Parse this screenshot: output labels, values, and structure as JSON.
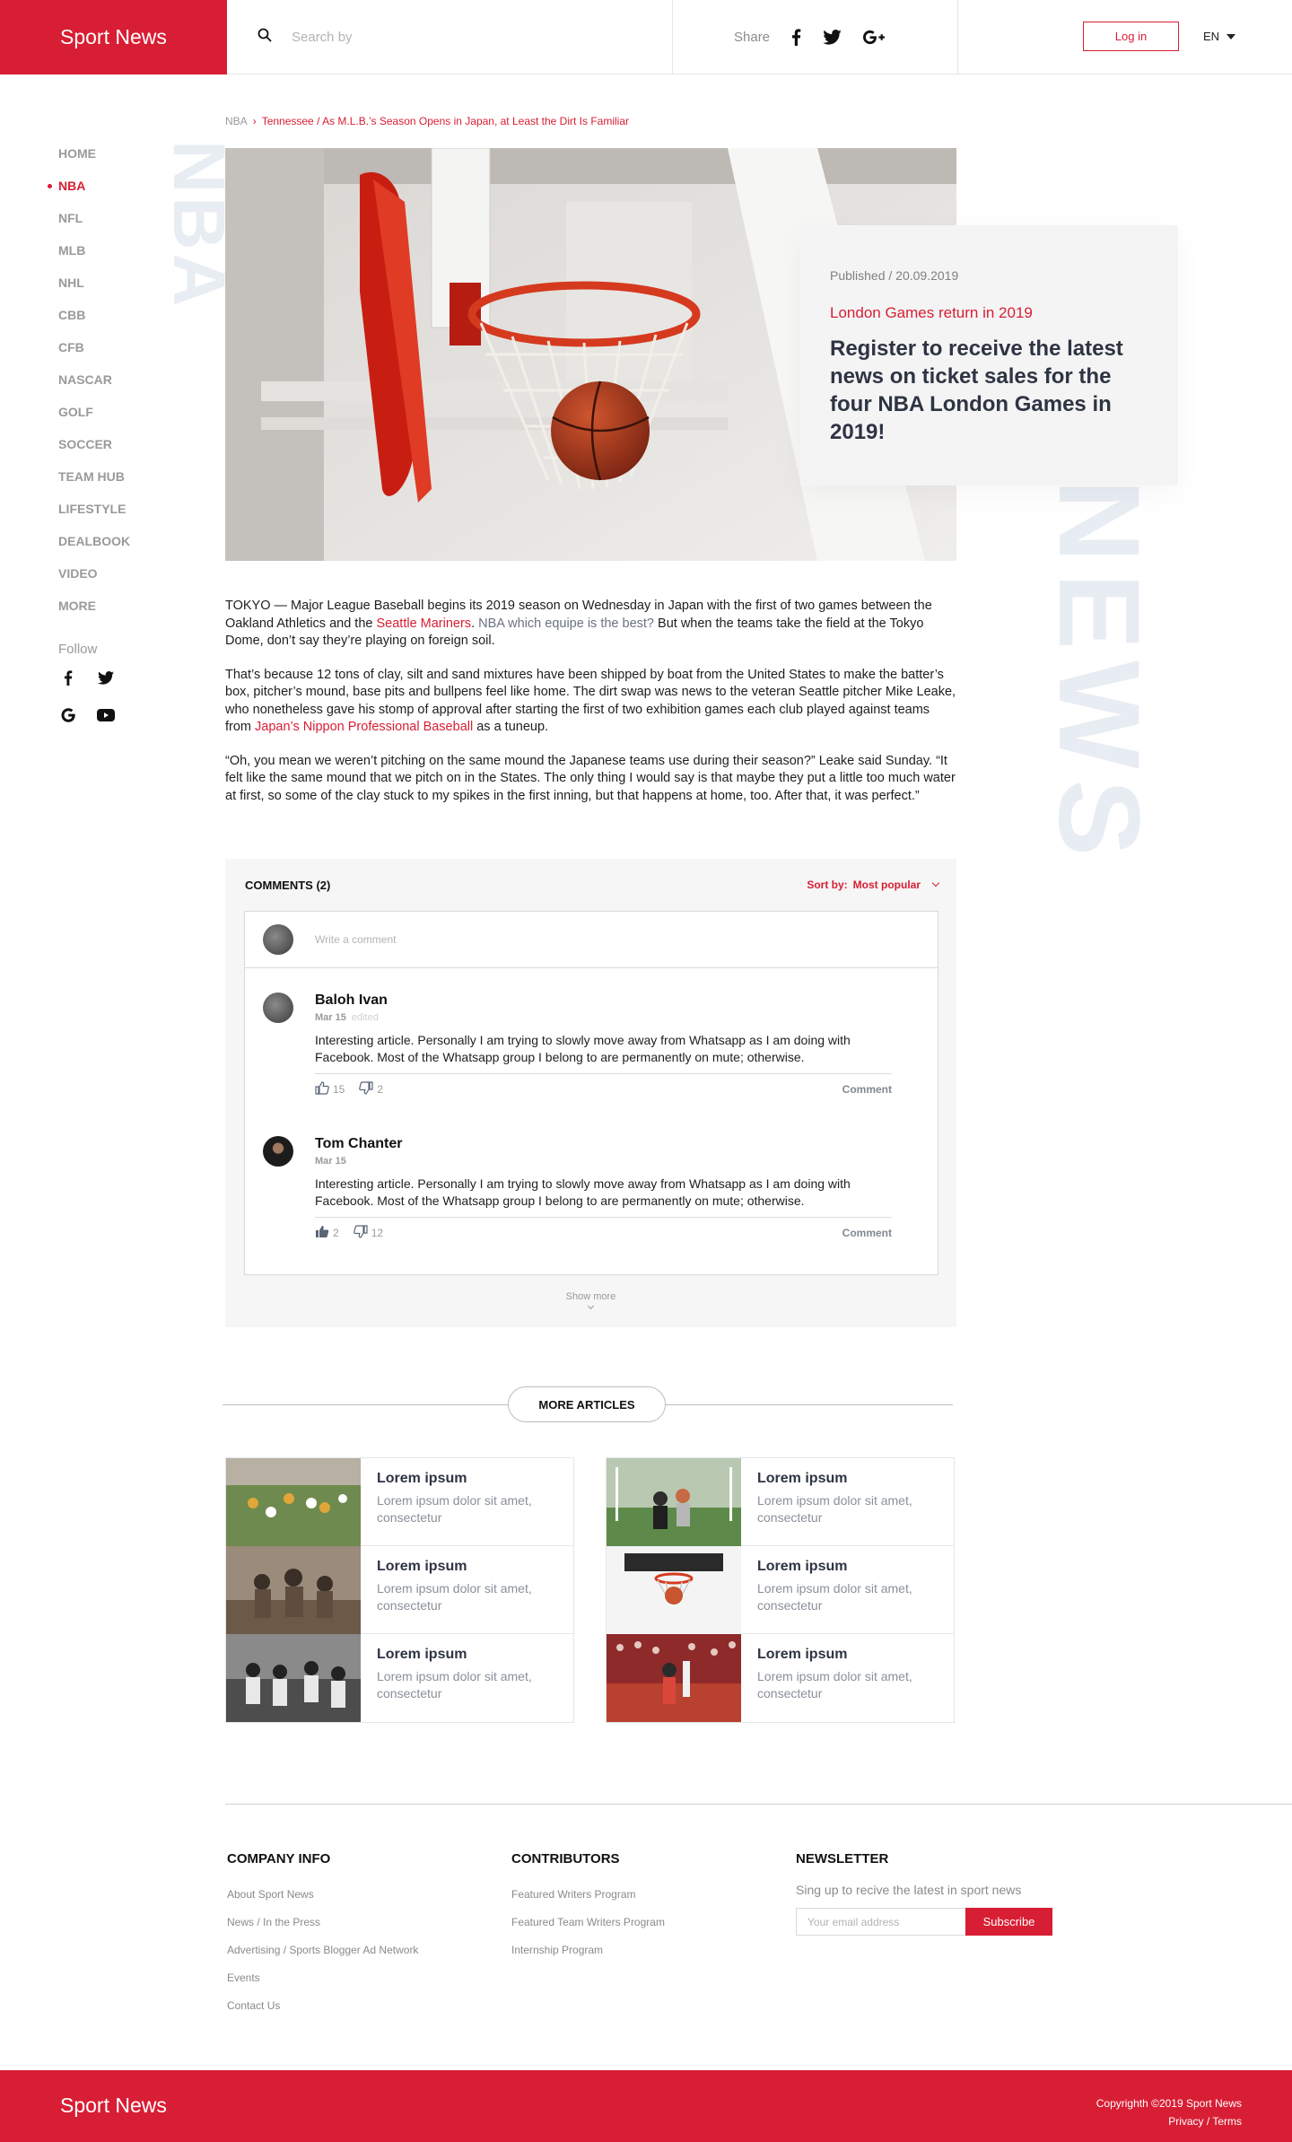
{
  "header": {
    "logo": "Sport News",
    "search_placeholder": "Search by",
    "share_label": "Share",
    "login_label": "Log in",
    "language": "EN"
  },
  "sidebar": {
    "items": [
      {
        "label": "HOME",
        "active": false
      },
      {
        "label": "NBA",
        "active": true
      },
      {
        "label": "NFL",
        "active": false
      },
      {
        "label": "MLB",
        "active": false
      },
      {
        "label": "NHL",
        "active": false
      },
      {
        "label": "CBB",
        "active": false
      },
      {
        "label": "CFB",
        "active": false
      },
      {
        "label": "NASCAR",
        "active": false
      },
      {
        "label": "GOLF",
        "active": false
      },
      {
        "label": "SOCCER",
        "active": false
      },
      {
        "label": "TEAM HUB",
        "active": false
      },
      {
        "label": "LIFESTYLE",
        "active": false
      },
      {
        "label": "DEALBOOK",
        "active": false
      },
      {
        "label": "VIDEO",
        "active": false
      },
      {
        "label": "MORE",
        "active": false
      }
    ],
    "follow_label": "Follow",
    "social_icons": [
      "facebook-icon",
      "twitter-icon",
      "google-icon",
      "youtube-icon"
    ]
  },
  "watermarks": {
    "section": "NBA",
    "brand": "NEWS"
  },
  "breadcrumb": {
    "root": "NBA",
    "current": "Tennessee / As M.L.B.’s Season Opens in Japan, at Least the Dirt Is Familiar"
  },
  "publish_card": {
    "date": "Published / 20.09.2019",
    "kicker": "London Games return in 2019",
    "title": "Register to receive the latest news on ticket sales for the four NBA London Games in 2019!"
  },
  "article": {
    "p1_a": "TOKYO — Major League Baseball begins its 2019 season on Wednesday in Japan with the first of two games between the Oakland Athletics and the ",
    "p1_link": "Seattle Mariners",
    "p1_b": ". ",
    "p1_gray": "NBA which equipe is the best?",
    "p1_c": " But when the teams take the field at the Tokyo Dome, don’t say they’re playing on foreign soil.",
    "p2_a": "That’s because 12 tons of clay, silt and sand mixtures have been shipped by boat from the United States to make the batter’s box, pitcher’s mound, base pits and bullpens feel like home. The dirt swap was news to the veteran Seattle pitcher Mike Leake, who nonetheless gave his stomp of approval after starting the first of two exhibition games each club played against teams from ",
    "p2_link": "Japan’s Nippon Professional Baseball",
    "p2_b": " as a tuneup.",
    "p3": "“Oh, you mean we weren’t pitching on the same mound the Japanese teams use during their season?” Leake said Sunday. “It felt like the same mound that we pitch on in the States. The only thing I would say is that maybe they put a little too much water at first, so some of the clay stuck to my spikes in the first inning, but that happens at home, too. After that, it was perfect.”"
  },
  "comments": {
    "title": "COMMENTS (2)",
    "sort_label": "Sort by:",
    "sort_value": "Most popular",
    "write_placeholder": "Write a comment",
    "items": [
      {
        "name": "Baloh Ivan",
        "date": "Mar 15",
        "edited": "edited",
        "text": "Interesting article. Personally I am trying to slowly move away from Whatsapp as I am doing with Facebook. Most of the Whatsapp group I belong to are permanently on mute; otherwise.",
        "likes": "15",
        "dislikes": "2",
        "reply_label": "Comment"
      },
      {
        "name": "Tom Chanter",
        "date": "Mar 15",
        "edited": "",
        "text": "Interesting article. Personally I am trying to slowly move away from Whatsapp as I am doing with Facebook. Most of the Whatsapp group I belong to are permanently on mute; otherwise.",
        "likes": "2",
        "dislikes": "12",
        "reply_label": "Comment"
      }
    ],
    "show_more": "Show more"
  },
  "more_articles": {
    "button": "MORE ARTICLES",
    "items": [
      {
        "title": "Lorem ipsum",
        "text": "Lorem ipsum dolor sit amet, consectetur"
      },
      {
        "title": "Lorem ipsum",
        "text": "Lorem ipsum dolor sit amet, consectetur"
      },
      {
        "title": "Lorem ipsum",
        "text": "Lorem ipsum dolor sit amet, consectetur"
      },
      {
        "title": "Lorem ipsum",
        "text": "Lorem ipsum dolor sit amet, consectetur"
      },
      {
        "title": "Lorem ipsum",
        "text": "Lorem ipsum dolor sit amet, consectetur"
      },
      {
        "title": "Lorem ipsum",
        "text": "Lorem ipsum dolor sit amet, consectetur"
      }
    ]
  },
  "footer": {
    "company": {
      "title": "COMPANY INFO",
      "links": [
        "About Sport News",
        "News / In the Press",
        "Advertising / Sports Blogger Ad Network",
        "Events",
        "Contact Us"
      ]
    },
    "contributors": {
      "title": "CONTRIBUTORS",
      "links": [
        "Featured Writers Program",
        "Featured Team Writers Program",
        "Internship Program"
      ]
    },
    "newsletter": {
      "title": "NEWSLETTER",
      "subtitle": "Sing up to recive the latest in sport news",
      "email_placeholder": "Your email address",
      "subscribe_label": "Subscribe"
    },
    "bottom_logo": "Sport News",
    "copyright": "Copyrighth ©2019 Sport News",
    "legal": "Privacy / Terms"
  },
  "colors": {
    "accent": "#d81e34",
    "heading_dark": "#2e3443",
    "watermark": "#e8edf3"
  }
}
